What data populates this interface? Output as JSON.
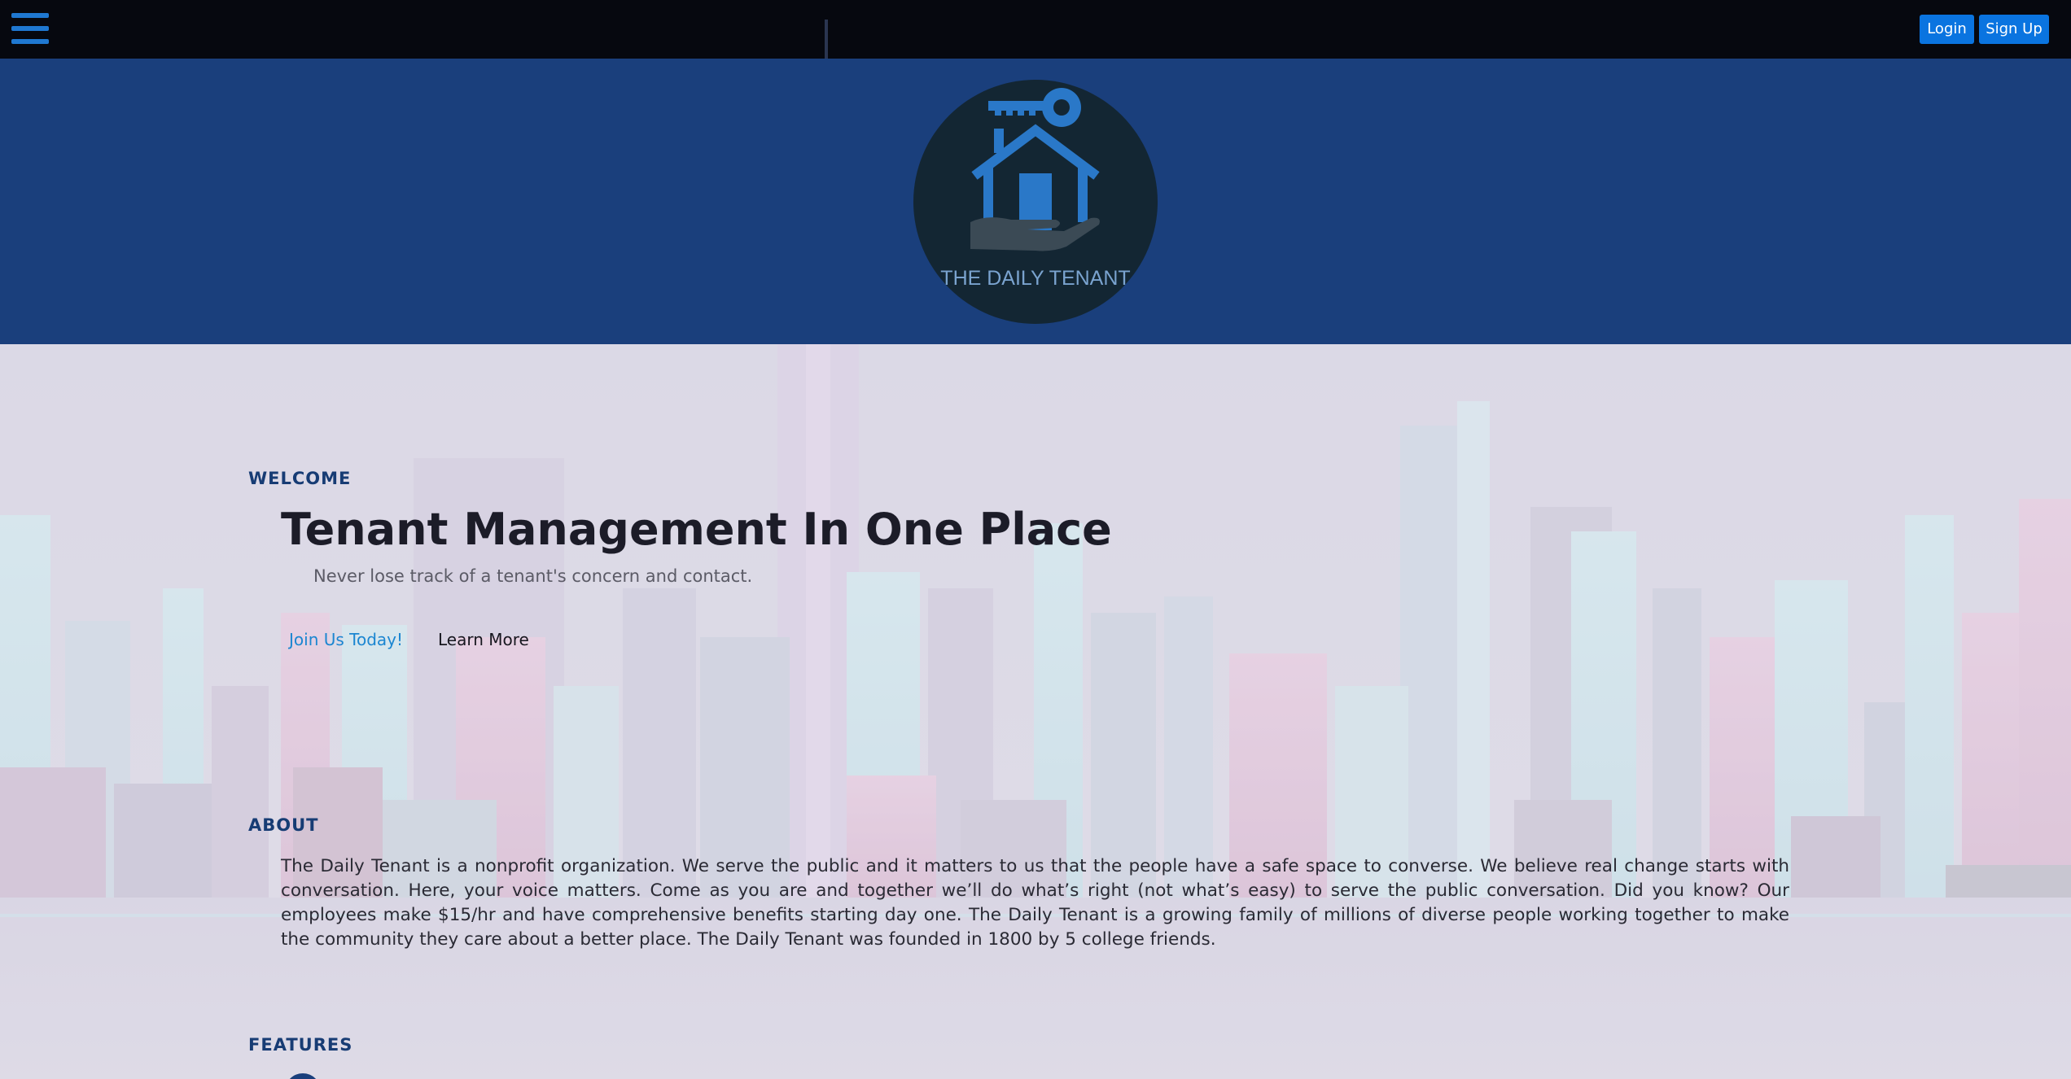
{
  "nav": {
    "login_label": "Login",
    "signup_label": "Sign Up",
    "button_color": "#0a74e0",
    "background": "#06080f"
  },
  "banner": {
    "background": "#1a3f7c",
    "logo_text": "THE DAILY TENANT"
  },
  "hero": {
    "eyebrow": "WELCOME",
    "title": "Tenant Management In One Place",
    "subtitle": "Never lose track of a tenant's concern and contact.",
    "join_label": "Join Us Today!",
    "learn_label": "Learn More"
  },
  "about": {
    "heading": "ABOUT",
    "text": "The Daily Tenant is a nonprofit organization. We serve the public and it matters to us that the people have a safe space to converse. We believe real change starts with conversation. Here, your voice matters. Come as you are and together we’ll do what’s right (not what’s easy) to serve the public conversation. Did you know? Our employees make $15/hr and have comprehensive benefits starting day one. The Daily Tenant is a growing family of millions of diverse people working together to make the community they care about a better place. The Daily Tenant was founded in 1800 by 5 college friends."
  },
  "features": {
    "heading": "FEATURES"
  }
}
